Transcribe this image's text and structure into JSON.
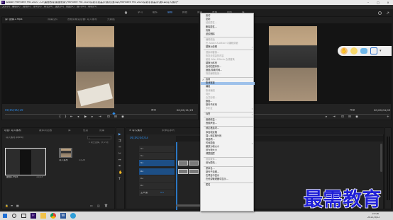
{
  "window": {
    "title": "Adobe Premiere Pro 2020 - D:\\最需教育\\最需教育\\Premiere Pro 2020从新手到高手\\素材\\第3章\\Premiere Pro 2020从新手到高手\\第3章\\导入素材*",
    "app_icon": "Pr"
  },
  "menubar": [
    "文件(F)",
    "编辑(E)",
    "剪辑(C)",
    "序列(S)",
    "标记(M)",
    "图形(G)",
    "视图(V)",
    "窗口(W)",
    "帮助(H)"
  ],
  "workspaces": {
    "items": [
      "学习",
      "组件",
      "编辑",
      "颜色",
      "效果",
      "音频",
      "图形",
      "库"
    ],
    "active_index": 2
  },
  "source_monitor": {
    "tabs": [
      "源: 图像1.mp4",
      "效果控件",
      "音频剪辑混合器: 导入素材",
      "元数据"
    ],
    "timecode_left": "00;00;00;19",
    "timecode_right": "00;00;11;23",
    "fit": "适合"
  },
  "program_monitor": {
    "timecode_right": "00;00;04;03",
    "fit": "完整"
  },
  "project_panel": {
    "tabs": [
      "项目: 导入素材",
      "媒体浏览器",
      "库",
      "信息",
      "效果"
    ],
    "project_file": "导入素材.prproj",
    "item_count": "1 项已选择，共 2 项",
    "items": [
      {
        "name": "图像1.mp4",
        "duration": "11;23"
      },
      {
        "name": "导入素材",
        "duration": "11;23"
      }
    ]
  },
  "timeline_panel": {
    "tabs": [
      "× 导入素材",
      "未命名序列"
    ],
    "timecode": "00;00;04;03",
    "tracks": [
      "V3",
      "V2",
      "V1",
      "A1",
      "A2",
      "A3",
      "主声道"
    ],
    "master_value": "0.0"
  },
  "context_menu": {
    "highlighted": "取消链接",
    "items": [
      {
        "label": "剪切",
        "disabled": false
      },
      {
        "label": "复制",
        "disabled": false
      },
      {
        "label": "粘贴属性...",
        "disabled": true
      },
      {
        "label": "删除属性...",
        "disabled": false
      },
      {
        "label": "清除",
        "disabled": false
      },
      {
        "label": "波纹删除",
        "disabled": false
      },
      {
        "sep": true
      },
      {
        "label": "编辑原始",
        "disabled": true
      },
      {
        "label": "在 Adobe Audition 中编辑剪辑",
        "disabled": true
      },
      {
        "label": "替换为剪辑",
        "disabled": false,
        "arrow": true
      },
      {
        "sep": true
      },
      {
        "label": "渲染和替换...",
        "disabled": true
      },
      {
        "label": "恢复未渲染的内容",
        "disabled": true
      },
      {
        "label": "使用 After Effects 合成替换",
        "disabled": true
      },
      {
        "label": "替换为序列",
        "disabled": false
      },
      {
        "label": "自动匹配序列...",
        "disabled": false
      },
      {
        "label": "速度/持续时间...",
        "disabled": false
      },
      {
        "label": "场景编辑检测...",
        "disabled": true
      },
      {
        "sep": true
      },
      {
        "label": "启用",
        "disabled": false,
        "check": true
      },
      {
        "label": "取消链接",
        "disabled": false
      },
      {
        "label": "编组",
        "disabled": false
      },
      {
        "label": "取消编组",
        "disabled": true
      },
      {
        "label": "同步",
        "disabled": true
      },
      {
        "label": "合并剪辑...",
        "disabled": true
      },
      {
        "label": "嵌套...",
        "disabled": false
      },
      {
        "label": "制作子序列",
        "disabled": false
      },
      {
        "label": "多机位",
        "disabled": true,
        "arrow": true
      },
      {
        "sep": true
      },
      {
        "label": "标签",
        "disabled": false,
        "arrow": true
      },
      {
        "sep": true
      },
      {
        "label": "音频增益...",
        "disabled": false
      },
      {
        "label": "音频声道...",
        "disabled": false
      },
      {
        "sep": true
      },
      {
        "label": "帧定格选项...",
        "disabled": false
      },
      {
        "label": "添加帧定格",
        "disabled": false
      },
      {
        "label": "插入帧定格分段",
        "disabled": false
      },
      {
        "label": "场选项...",
        "disabled": false
      },
      {
        "label": "时间插值",
        "disabled": false,
        "arrow": true
      },
      {
        "label": "缩放为帧大小",
        "disabled": false
      },
      {
        "label": "设为帧大小",
        "disabled": false
      },
      {
        "label": "调整图层",
        "disabled": false
      },
      {
        "sep": true
      },
      {
        "label": "链接媒体...",
        "disabled": true
      },
      {
        "label": "设为脱机...",
        "disabled": false
      },
      {
        "sep": true
      },
      {
        "label": "重命名...",
        "disabled": false
      },
      {
        "label": "制作子剪辑...",
        "disabled": false
      },
      {
        "label": "在项目中显示",
        "disabled": false
      },
      {
        "label": "在资源管理器中显示...",
        "disabled": false
      },
      {
        "sep": true
      },
      {
        "label": "属性",
        "disabled": false
      }
    ]
  },
  "watermark": "最需教育",
  "taskbar": {
    "time": "15:08",
    "date": "2021/3/22",
    "apps": [
      "windows-start",
      "search",
      "task-view",
      "premiere",
      "explorer",
      "chrome",
      "word",
      "edge"
    ]
  },
  "colors": {
    "accent": "#2d8ceb",
    "menu_highlight": "#9ec1ea",
    "video_clip": "#5b59a7",
    "audio_clip": "#3f8f6e",
    "watermark": "#1f1fd6"
  }
}
